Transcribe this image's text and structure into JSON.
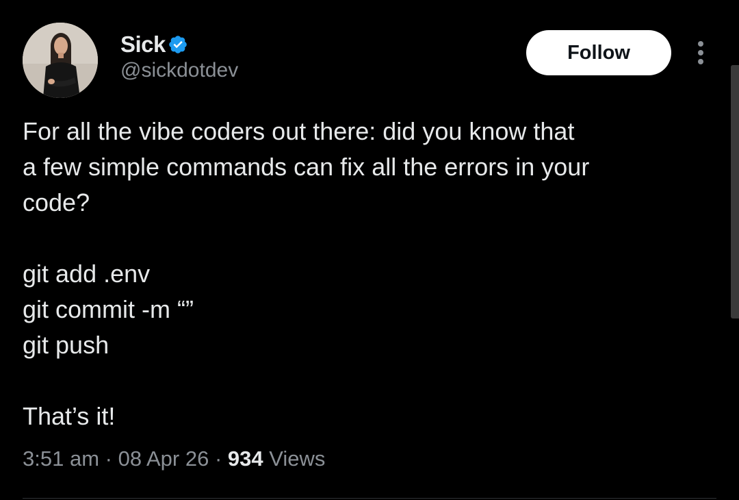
{
  "author": {
    "display_name": "Sick",
    "handle": "@sickdotdev",
    "verified": true
  },
  "actions": {
    "follow_label": "Follow"
  },
  "tweet": {
    "lines": [
      "For all the vibe coders out there: did you know that",
      "a few simple commands can fix all the errors in your",
      "code?",
      "",
      "git add .env",
      "git commit -m “”",
      "git push",
      "",
      "That’s it!"
    ]
  },
  "meta": {
    "time": "3:51 am",
    "date": "08 Apr 26",
    "views_count": "934",
    "views_label": "Views",
    "separator": "·"
  },
  "colors": {
    "background": "#000000",
    "text_primary": "#e7e9ea",
    "text_secondary": "#8b9096",
    "verified_blue": "#1d9bf0",
    "follow_bg": "#ffffff"
  },
  "icons": [
    "verified-badge-icon",
    "more-options-icon"
  ]
}
